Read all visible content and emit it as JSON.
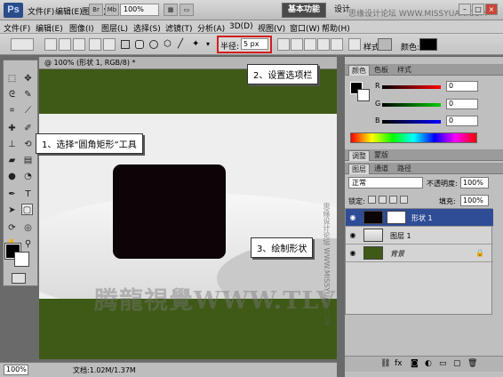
{
  "app": {
    "logo": "Ps",
    "menus": [
      "文件(F)",
      "编辑(E)",
      "图像(I)",
      "图层(L)",
      "选择(S)",
      "滤镜(T)",
      "分析(A)",
      "3D(D)",
      "视图(V)",
      "窗口(W)",
      "帮助(H)"
    ],
    "bridge_icon": "Br",
    "minibridge_icon": "Mb",
    "zoom": "100%",
    "workspace_active": "基本功能",
    "workspace_other": "设计",
    "site_watermark": "思缘设计论坛 WWW.MISSYUAN.COM"
  },
  "options": {
    "radius_label": "半径:",
    "radius_value": "5 px",
    "style_label": "样式:",
    "color_label": "颜色:",
    "fill_color": "#000000"
  },
  "document": {
    "tab_title": "@ 100% (形状 1, RGB/8) *",
    "zoom_field": "100%",
    "doc_info": "文档:1.02M/1.37M",
    "band_color": "#3f5a16",
    "shape_color": "#0c0406",
    "watermark": "腾龍視覺WWW.TLVI.NET",
    "side_watermark": "思缘设计论坛 WWW.MISSYUAN.COM"
  },
  "callouts": {
    "step1": "1、选择“圆角矩形”工具",
    "step2": "2、设置选项栏",
    "step3": "3、绘制形状"
  },
  "color_panel": {
    "tabs": [
      "颜色",
      "色板",
      "样式"
    ],
    "channels": [
      {
        "label": "R",
        "value": "0",
        "color": "#d01010"
      },
      {
        "label": "G",
        "value": "0",
        "color": "#10a010"
      },
      {
        "label": "B",
        "value": "0",
        "color": "#1030d0"
      }
    ]
  },
  "adjust_tabs": [
    "调整",
    "蒙版"
  ],
  "layers_panel": {
    "tabs": [
      "图层",
      "通道",
      "路径"
    ],
    "blend_mode": "正常",
    "opacity_label": "不透明度:",
    "opacity_value": "100%",
    "lock_label": "锁定:",
    "fill_label": "填充:",
    "fill_value": "100%",
    "layers": [
      {
        "name": "形状 1",
        "selected": true
      },
      {
        "name": "图层 1",
        "selected": false
      },
      {
        "name": "背景",
        "selected": false
      }
    ]
  }
}
